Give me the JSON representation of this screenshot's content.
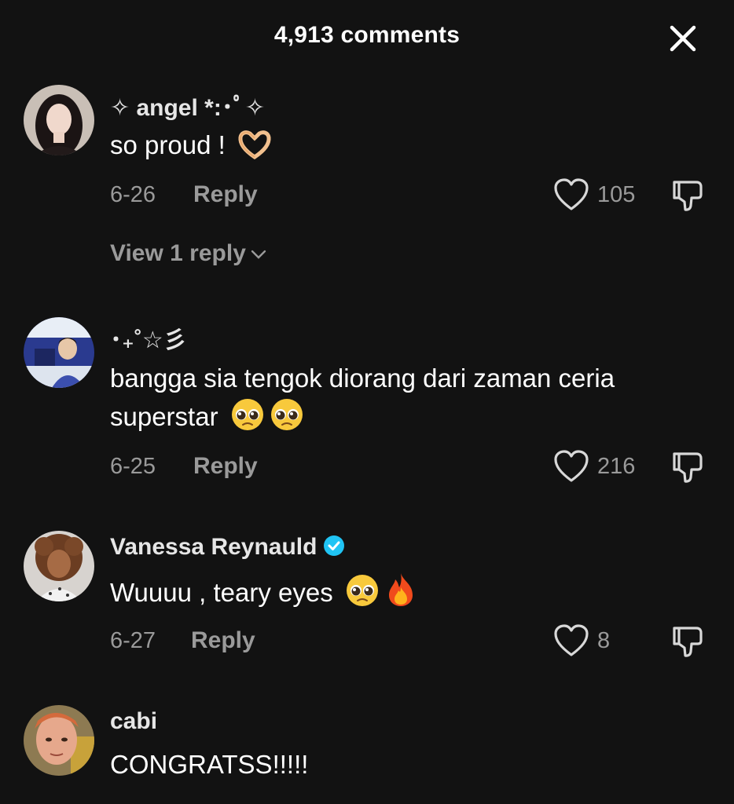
{
  "header": {
    "title": "4,913 comments",
    "close_icon": "close-icon"
  },
  "comments": [
    {
      "username": "✧ angel *:･ﾟ✧",
      "text": "so proud !",
      "emoji": [
        "heart-hands-emoji"
      ],
      "date": "6-26",
      "reply_label": "Reply",
      "likes": "105",
      "view_replies": "View 1 reply"
    },
    {
      "username": "･₊˚☆彡",
      "text": "bangga sia tengok diorang dari zaman ceria superstar",
      "emoji": [
        "pleading-face-emoji",
        "pleading-face-emoji"
      ],
      "date": "6-25",
      "reply_label": "Reply",
      "likes": "216"
    },
    {
      "username": "Vanessa Reynauld",
      "verified": true,
      "text": "Wuuuu , teary eyes",
      "emoji": [
        "pleading-face-emoji",
        "fire-emoji"
      ],
      "date": "6-27",
      "reply_label": "Reply",
      "likes": "8"
    },
    {
      "username": "cabi",
      "text": "CONGRATSS!!!!!"
    }
  ],
  "colors": {
    "background": "#121212",
    "primary_text": "#ffffff",
    "secondary_text": "#9a9a9a",
    "verified_badge": "#20c4f4"
  }
}
